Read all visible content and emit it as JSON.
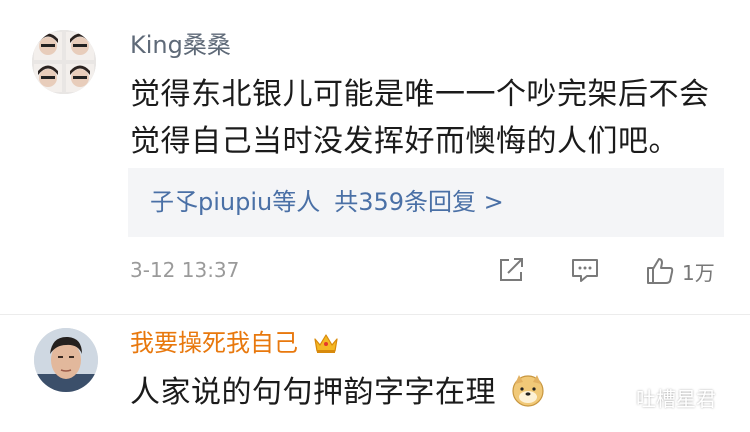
{
  "comments": [
    {
      "username": "King桑桑",
      "lines": [
        "觉得东北银儿可能是唯一一个吵完架后不会",
        "觉得自己当时没发挥好而懊悔的人们吧。"
      ],
      "replies": {
        "users": "子孓piupiu等人",
        "count": "共359条回复 >"
      },
      "time": "3-12 13:37",
      "likes": "1万",
      "icons": {
        "share": "share-icon",
        "reply": "comment-icon",
        "like": "thumbs-up-icon"
      }
    },
    {
      "username": "我要操死我自己",
      "badge": "crown-icon",
      "text": "人家说的句句押韵字字在理",
      "emoji": "doge-icon"
    }
  ],
  "watermark": {
    "text": "吐槽星君",
    "icon": "wechat-icon"
  },
  "colors": {
    "link": "#4a70a6",
    "vip_name": "#e8780d",
    "name": "#5f6a78",
    "gray": "#9a9a9a"
  }
}
